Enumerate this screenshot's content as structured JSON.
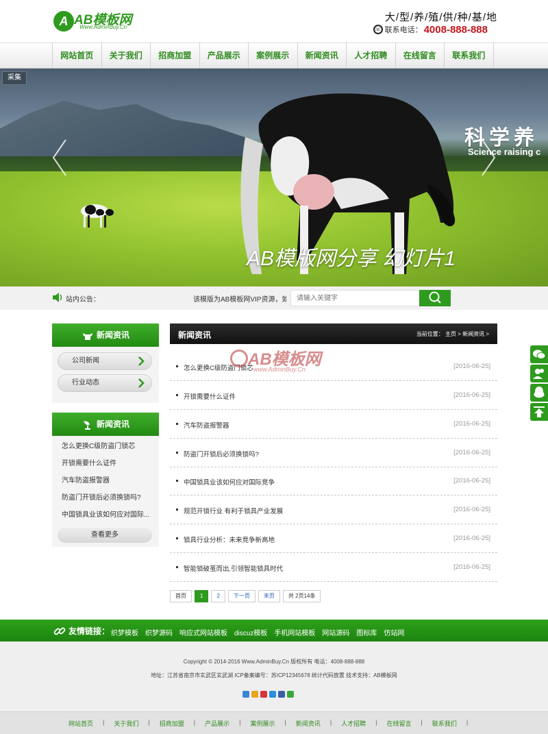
{
  "header": {
    "logo_text": "AB模板网",
    "logo_url": "Www.AdminBuy.Cn",
    "slogan": "大/型/养/殖/供/种/基/地",
    "phone_label": "联系电话：",
    "phone_number": "4008-888-888"
  },
  "nav": {
    "items": [
      "网站首页",
      "关于我们",
      "招商加盟",
      "产品展示",
      "案例展示",
      "新闻资讯",
      "人才招聘",
      "在线留言",
      "联系我们"
    ]
  },
  "banner": {
    "tag": "采集",
    "heading": "科学养",
    "subheading": "Science raising c",
    "caption": "AB模版网分享 幻灯片1"
  },
  "notice": {
    "label": "站内公告：",
    "text": "该模版为AB模板网VIP资源，如",
    "search_placeholder": "请输入关键字"
  },
  "sidebar": {
    "categories_title": "新闻资讯",
    "categories": [
      "公司新闻",
      "行业动态"
    ],
    "latest_title": "新闻资讯",
    "latest": [
      "怎么更换C级防盗门锁芯",
      "开锁需要什么证件",
      "汽车防盗报警器",
      "防盗门开锁后必须换锁吗?",
      "中国锁具业该如何应对国际..."
    ],
    "more_label": "查看更多"
  },
  "main": {
    "title": "新闻资讯",
    "breadcrumb": "当前位置： 主页 > 新闻资讯 >",
    "watermark_title": "AB模板网",
    "watermark_url": "www.AdminBuy.Cn",
    "news": [
      {
        "title": "怎么更换C级防盗门锁芯",
        "date": "[2016-06-25]"
      },
      {
        "title": "开锁需要什么证件",
        "date": "[2016-06-25]"
      },
      {
        "title": "汽车防盗报警器",
        "date": "[2016-06-25]"
      },
      {
        "title": "防盗门开锁后必须换锁吗?",
        "date": "[2016-06-25]"
      },
      {
        "title": "中国锁具业该如何应对国际竞争",
        "date": "[2016-06-25]"
      },
      {
        "title": "规范开锁行业 有利于锁具产业发展",
        "date": "[2016-06-25]"
      },
      {
        "title": "锁具行业分析：未来竞争新高地",
        "date": "[2016-06-25]"
      },
      {
        "title": "智能锁破茧而出,引领智能锁具时代",
        "date": "[2016-06-25]"
      }
    ],
    "pager": {
      "first": "首页",
      "pages": [
        "1",
        "2"
      ],
      "next": "下一页",
      "last": "末页",
      "total": "共 2页14条"
    }
  },
  "friend_links": {
    "label": "友情链接：",
    "items": [
      "织梦模板",
      "织梦源码",
      "响应式网站模板",
      "discuz模板",
      "手机网站模板",
      "网站源码",
      "图标库",
      "仿站网"
    ]
  },
  "footer": {
    "copyright": "Copyright © 2014-2016 Www.AdminBuy.Cn 版权所有    电话：4008-888-888",
    "address": "地址：江苏省南京市玄武区玄武湖    ICP备案编号：苏ICP12345678    统计代码放置    技术支持：AB模板网",
    "bottom_nav": [
      "网站首页",
      "关于我们",
      "招商加盟",
      "产品展示",
      "案例展示",
      "新闻资讯",
      "人才招聘",
      "在线留言",
      "联系我们"
    ]
  },
  "colors": {
    "brand_green": "#2e9a1e",
    "phone_red": "#c4161c",
    "header_dark": "#111111"
  }
}
